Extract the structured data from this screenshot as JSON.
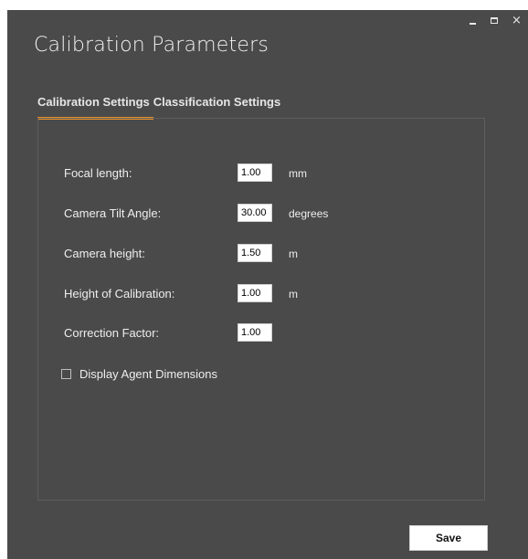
{
  "window": {
    "title": "Calibration Parameters",
    "controls": {
      "minimize_icon": "minimize-icon",
      "maximize_icon": "maximize-icon",
      "close_icon": "close-icon",
      "close_glyph": "×"
    }
  },
  "tabs": [
    {
      "label": "Calibration Settings",
      "active": true
    },
    {
      "label": "Classification Settings",
      "active": false
    }
  ],
  "fields": [
    {
      "label": "Focal length:",
      "value": "1.00",
      "unit": "mm"
    },
    {
      "label": "Camera Tilt Angle:",
      "value": "30.00",
      "unit": "degrees"
    },
    {
      "label": "Camera height:",
      "value": "1.50",
      "unit": "m"
    },
    {
      "label": "Height of Calibration:",
      "value": "1.00",
      "unit": "m"
    },
    {
      "label": "Correction Factor:",
      "value": "1.00",
      "unit": ""
    }
  ],
  "checkbox": {
    "label": "Display Agent Dimensions",
    "checked": false
  },
  "actions": {
    "save_label": "Save"
  },
  "colors": {
    "background": "#4a4a4a",
    "accent": "#e8902a",
    "panel_border": "#5e5e5e",
    "text": "#eeeeee"
  }
}
